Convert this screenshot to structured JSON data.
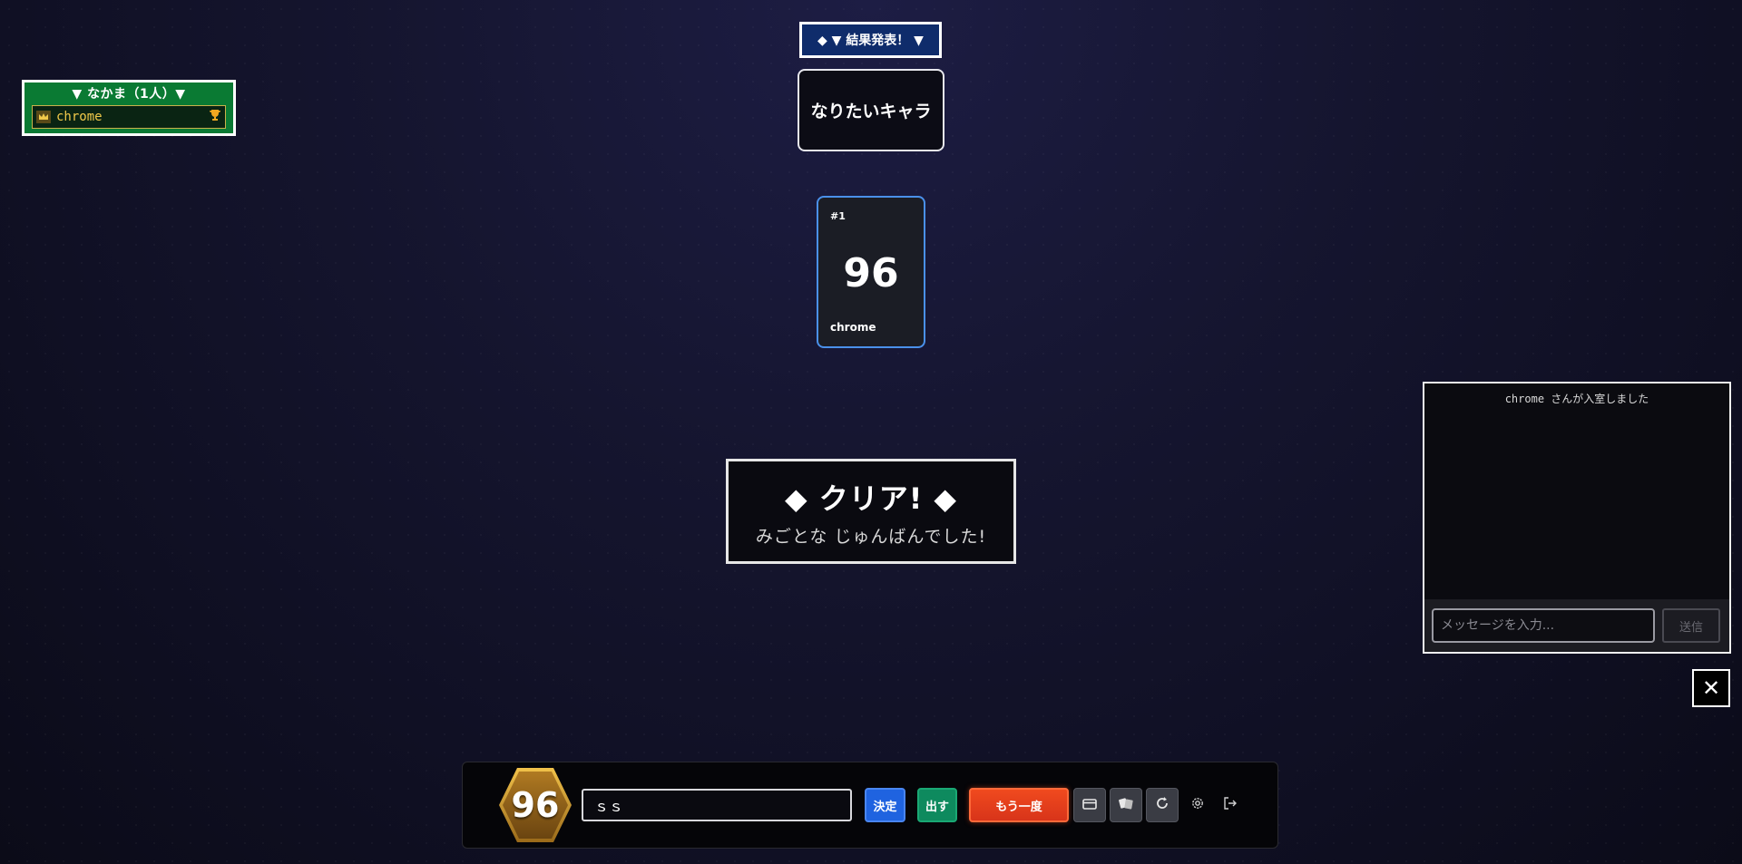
{
  "party": {
    "title": "▼ なかま（1人）▼",
    "members": [
      {
        "name": "chrome"
      }
    ]
  },
  "result": {
    "header": "◆ ▼ 結果発表！ ▼",
    "theme": "なりたいキャラ"
  },
  "card": {
    "rank": "#1",
    "number": "96",
    "player": "chrome"
  },
  "clear": {
    "title": "◆ クリア! ◆",
    "subtitle": "みごとな じゅんばんでした!"
  },
  "chat": {
    "messages": [
      "chrome さんが入室しました"
    ],
    "placeholder": "メッセージを入力...",
    "send_label": "送信"
  },
  "close_label": "✕",
  "bottom_bar": {
    "my_number": "96",
    "word_value": "ｓｓ",
    "decide_label": "決定",
    "play_label": "出す",
    "again_label": "もう一度"
  },
  "icons": {
    "crown": "crown-icon",
    "trophy": "trophy-icon",
    "card": "card-icon",
    "cards": "cards-icon",
    "refresh": "refresh-icon",
    "settings": "gear-icon",
    "exit": "exit-icon"
  },
  "colors": {
    "party_bg": "#0a7a33",
    "result_header_bg": "#0f2c6b",
    "card_border": "#4a90ea",
    "decide": "#1f63e0",
    "play": "#0e8a5e",
    "again": "#f04a1e",
    "gold": "#f1c94a"
  }
}
